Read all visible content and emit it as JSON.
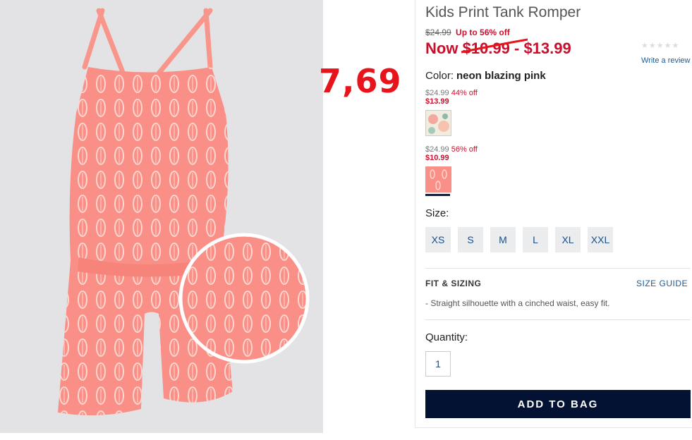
{
  "annotation": {
    "handwritten_price": "7,69"
  },
  "product": {
    "title": "Kids Print Tank Romper",
    "original_price": "$24.99",
    "discount_text": "Up to 56% off",
    "now_prefix": "Now",
    "now_low": "$10.99",
    "now_sep": " - ",
    "now_high": "$13.99",
    "price_color": "#c8102e",
    "review": {
      "stars": "★★★★★",
      "link": "Write a review"
    },
    "color": {
      "label": "Color:",
      "value": "neon blazing pink"
    },
    "swatches": [
      {
        "orig": "$24.99",
        "off": "44% off",
        "sale": "$13.99",
        "name": "floral-swatch"
      },
      {
        "orig": "$24.99",
        "off": "56% off",
        "sale": "$10.99",
        "name": "pink-swatch",
        "selected": true
      }
    ],
    "size": {
      "label": "Size:",
      "options": [
        "XS",
        "S",
        "M",
        "L",
        "XL",
        "XXL"
      ]
    },
    "fit": {
      "header": "FIT & SIZING",
      "guide": "SIZE GUIDE",
      "description": "- Straight silhouette with a cinched waist, easy fit."
    },
    "quantity": {
      "label": "Quantity:",
      "value": "1"
    },
    "add_button": "ADD TO BAG",
    "button_color": "#031133"
  }
}
